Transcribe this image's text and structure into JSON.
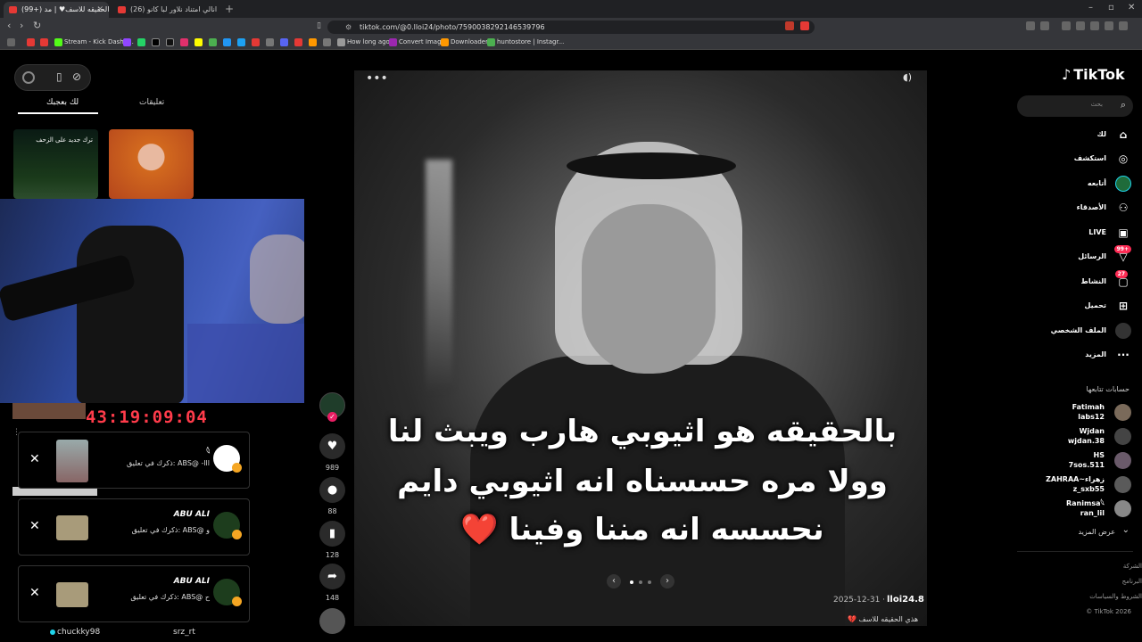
{
  "browser": {
    "tabs": [
      {
        "title": "(99+) هذي الحقيقه للاسف♥ | مد..."
      },
      {
        "title": "(26) حقيقت انالي امتناد نلاور لبا كانو..."
      }
    ],
    "url": "tiktok.com/@0.lloi24/photo/7590038292146539796",
    "bookmarks": [
      "Stream - Kick Dashb...",
      "How long ago",
      "Convert Image",
      "Downloader",
      "huntostore | Instagr..."
    ]
  },
  "left_panel": {
    "tabs": [
      "تعليقات",
      "لك بعجبك"
    ],
    "thumb1_caption": "ترك جديد على الزحف",
    "timer": "43:19:09:04",
    "notifications": [
      {
        "name": "𓆩",
        "text": "ذكرك في تعليق: ABS@ -lll"
      },
      {
        "name": "ABU ALI",
        "text": "ذكرك في تعليق: ABS@ و"
      },
      {
        "name": "ABU ALI",
        "text": "ذكرك في تعليق: ABS@ ح"
      }
    ],
    "bottom_users": [
      "chuckky98",
      "srz_rt"
    ]
  },
  "post": {
    "caption_lines": [
      "بالحقيقه هو اثيوبي هارب ويبث لنا",
      "وولا مره حسسناه انه اثيوبي دايم",
      "نحسسه انه مننا وفينا ❤️"
    ],
    "username": "lloi24.8",
    "date": "2025-12-31 ·",
    "description": "هذي الحقيقه للاسف 💔",
    "likes": "989",
    "comments": "88",
    "saves": "128",
    "shares": "148"
  },
  "sidebar": {
    "logo": "TikTok",
    "search_placeholder": "بحث",
    "nav": [
      {
        "label": "لك",
        "icon": "home-icon"
      },
      {
        "label": "استكشف",
        "icon": "compass-icon"
      },
      {
        "label": "أتابعه",
        "icon": "following-icon"
      },
      {
        "label": "الأصدقاء",
        "icon": "friends-icon"
      },
      {
        "label": "LIVE",
        "icon": "live-icon"
      },
      {
        "label": "الرسائل",
        "icon": "messages-icon",
        "badge": "99+"
      },
      {
        "label": "النشاط",
        "icon": "activity-icon",
        "badge": "27"
      },
      {
        "label": "تحميل",
        "icon": "upload-icon"
      },
      {
        "label": "الملف الشخصي",
        "icon": "profile-icon"
      },
      {
        "label": "المزيد",
        "icon": "more-icon"
      }
    ],
    "following_title": "حسابات تتابعها",
    "following": [
      {
        "line1": "Fatimah",
        "line2": "labs12"
      },
      {
        "line1": "Wjdan",
        "line2": "wjdan.38"
      },
      {
        "line1": "HS",
        "line2": "7sos.511"
      },
      {
        "line1": "ZAHRAA~زهراء",
        "line2": "z_sxb55"
      },
      {
        "line1": "Ranimsa𓆩",
        "line2": "ran_lil"
      }
    ],
    "see_more": "عرض المزيد",
    "footer": [
      "الشركة",
      "البرنامج",
      "الشروط والسياسات",
      "© TikTok 2026"
    ]
  },
  "colors": {
    "accent": "#fe2c55",
    "timer": "#ff3b4a"
  }
}
